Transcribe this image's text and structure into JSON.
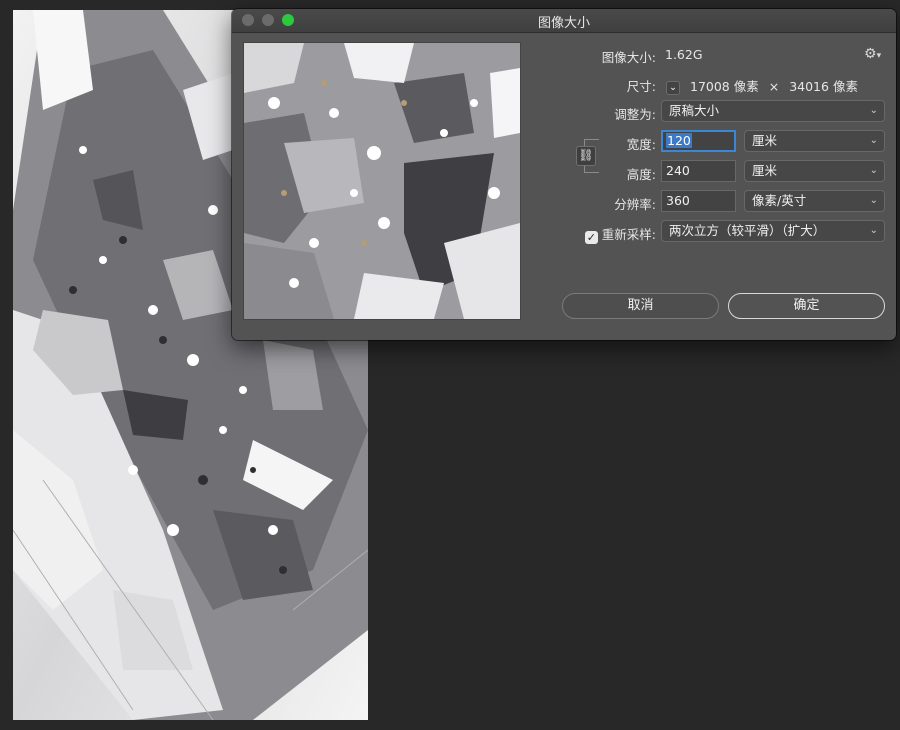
{
  "dialog": {
    "title": "图像大小",
    "image_size_label": "图像大小:",
    "image_size_value": "1.62G",
    "dimensions_label": "尺寸:",
    "dimensions_width": "17008 像素",
    "dimensions_sep": "×",
    "dimensions_height": "34016 像素",
    "fit_to_label": "调整为:",
    "fit_to_value": "原稿大小",
    "width_label": "宽度:",
    "width_value": "120",
    "width_unit": "厘米",
    "height_label": "高度:",
    "height_value": "240",
    "height_unit": "厘米",
    "resolution_label": "分辨率:",
    "resolution_value": "360",
    "resolution_unit": "像素/英寸",
    "resample_label": "重新采样:",
    "resample_checked": true,
    "resample_value": "两次立方（较平滑）（扩大）",
    "cancel_label": "取消",
    "ok_label": "确定"
  },
  "colors": {
    "dialog_bg": "#535353",
    "accent": "#3c86d6",
    "maximize": "#2bc840",
    "workspace": "#282828"
  },
  "icons": {
    "gear": "gear-icon",
    "link": "link-icon",
    "chevron": "chevron-down-icon",
    "check": "checkmark-icon"
  }
}
